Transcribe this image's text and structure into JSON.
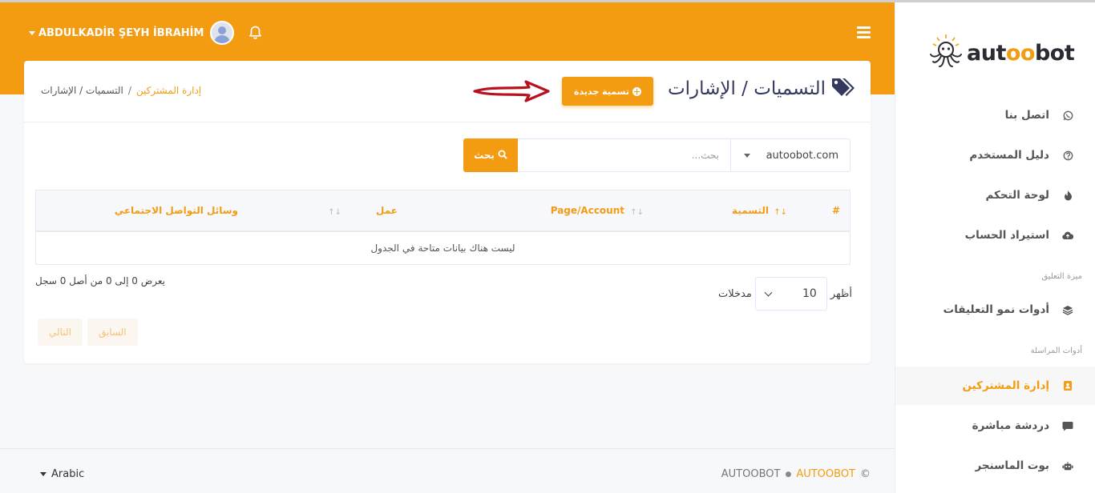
{
  "header": {
    "user_name": "ABDULKADİR ŞEYH İBRAHİM"
  },
  "page": {
    "title": "التسميات / الإشارات",
    "new_button_label": "تسمية جديدة",
    "breadcrumb": [
      "إدارة المشتركين",
      "التسميات / الإشارات"
    ]
  },
  "search": {
    "domain_value": "autoobot.com",
    "placeholder": "بحث...",
    "button_label": "بحث"
  },
  "table": {
    "columns": [
      "#",
      "التسمية",
      "Page/Account",
      "عمل",
      "وسائل التواصل الاجتماعي"
    ],
    "empty_message": "ليست هناك بيانات متاحة في الجدول",
    "info": "يعرض 0 إلى 0 من أصل 0 سجل",
    "show_label": "أظهر",
    "entries_label": "مدخلات",
    "page_length": "10",
    "prev_label": "السابق",
    "next_label": "التالي"
  },
  "footer": {
    "language": "Arabic",
    "copyright_symbol": "©",
    "brand_highlight": "AUTOOBOT",
    "brand": "AUTOOBOT"
  },
  "sidebar": {
    "logo_prefix": "aut",
    "logo_oo": "oo",
    "logo_suffix": "bot",
    "items": [
      {
        "label": "اتصل بنا",
        "icon": "whatsapp-icon"
      },
      {
        "label": "دليل المستخدم",
        "icon": "question-circle-icon"
      },
      {
        "label": "لوحة التحكم",
        "icon": "fire-icon"
      },
      {
        "label": "استيراد الحساب",
        "icon": "cloud-upload-icon"
      },
      {
        "label": "أدوات نمو التعليقات",
        "icon": "layers-icon"
      },
      {
        "label": "إدارة المشتركين",
        "icon": "address-card-icon"
      },
      {
        "label": "دردشة مباشرة",
        "icon": "comment-icon"
      },
      {
        "label": "بوت الماسنجر",
        "icon": "robot-icon"
      }
    ],
    "section_comment": "ميزة التعليق",
    "section_messaging": "أدوات المراسلة"
  },
  "colors": {
    "accent": "#f39c12",
    "title_text": "#34395e",
    "annotation_arrow": "#b8121f"
  }
}
